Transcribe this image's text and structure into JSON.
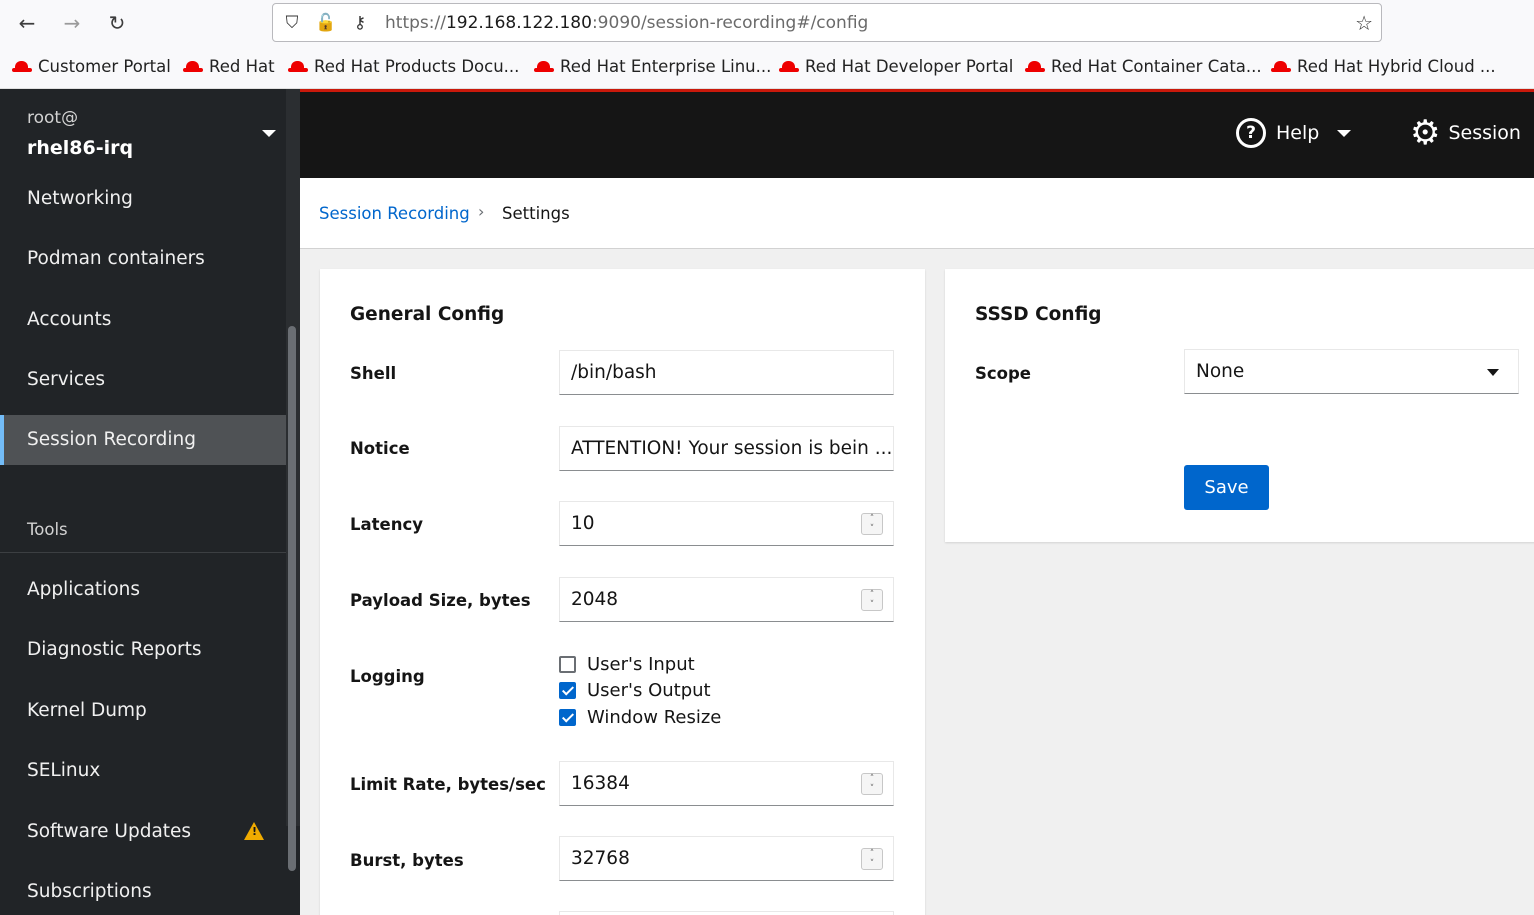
{
  "browser": {
    "url_prefix": "https://",
    "url_host": "192.168.122.180",
    "url_rest": ":9090/session-recording#/config",
    "bookmarks": [
      "Customer Portal",
      "Red Hat",
      "Red Hat Products Docu...",
      "Red Hat Enterprise Linu...",
      "Red Hat Developer Portal",
      "Red Hat Container Cata...",
      "Red Hat Hybrid Cloud ..."
    ]
  },
  "host": {
    "user": "root@",
    "name": "rhel86-irq"
  },
  "sidebar": {
    "items": [
      {
        "label": "Networking"
      },
      {
        "label": "Podman containers"
      },
      {
        "label": "Accounts"
      },
      {
        "label": "Services"
      },
      {
        "label": "Session Recording",
        "active": true
      }
    ],
    "tools_heading": "Tools",
    "tools": [
      {
        "label": "Applications"
      },
      {
        "label": "Diagnostic Reports"
      },
      {
        "label": "Kernel Dump"
      },
      {
        "label": "SELinux"
      },
      {
        "label": "Software Updates",
        "warning": true
      },
      {
        "label": "Subscriptions"
      }
    ]
  },
  "masthead": {
    "help_label": "Help",
    "session_label": "Session"
  },
  "breadcrumb": {
    "parent": "Session Recording",
    "current": "Settings"
  },
  "general": {
    "title": "General Config",
    "shell_label": "Shell",
    "shell_value": "/bin/bash",
    "notice_label": "Notice",
    "notice_value": "ATTENTION! Your session is bein ...",
    "latency_label": "Latency",
    "latency_value": "10",
    "payload_label": "Payload Size, bytes",
    "payload_value": "2048",
    "logging_label": "Logging",
    "logging_options": [
      {
        "label": "User's Input",
        "checked": false
      },
      {
        "label": "User's Output",
        "checked": true
      },
      {
        "label": "Window Resize",
        "checked": true
      }
    ],
    "limit_rate_label": "Limit Rate, bytes/sec",
    "limit_rate_value": "16384",
    "burst_label": "Burst, bytes",
    "burst_value": "32768"
  },
  "sssd": {
    "title": "SSSD Config",
    "scope_label": "Scope",
    "scope_value": "None",
    "save_label": "Save"
  },
  "colors": {
    "accent": "#0066cc",
    "masthead": "#151515",
    "sidebar": "#212427",
    "warning": "#f0ab00"
  }
}
